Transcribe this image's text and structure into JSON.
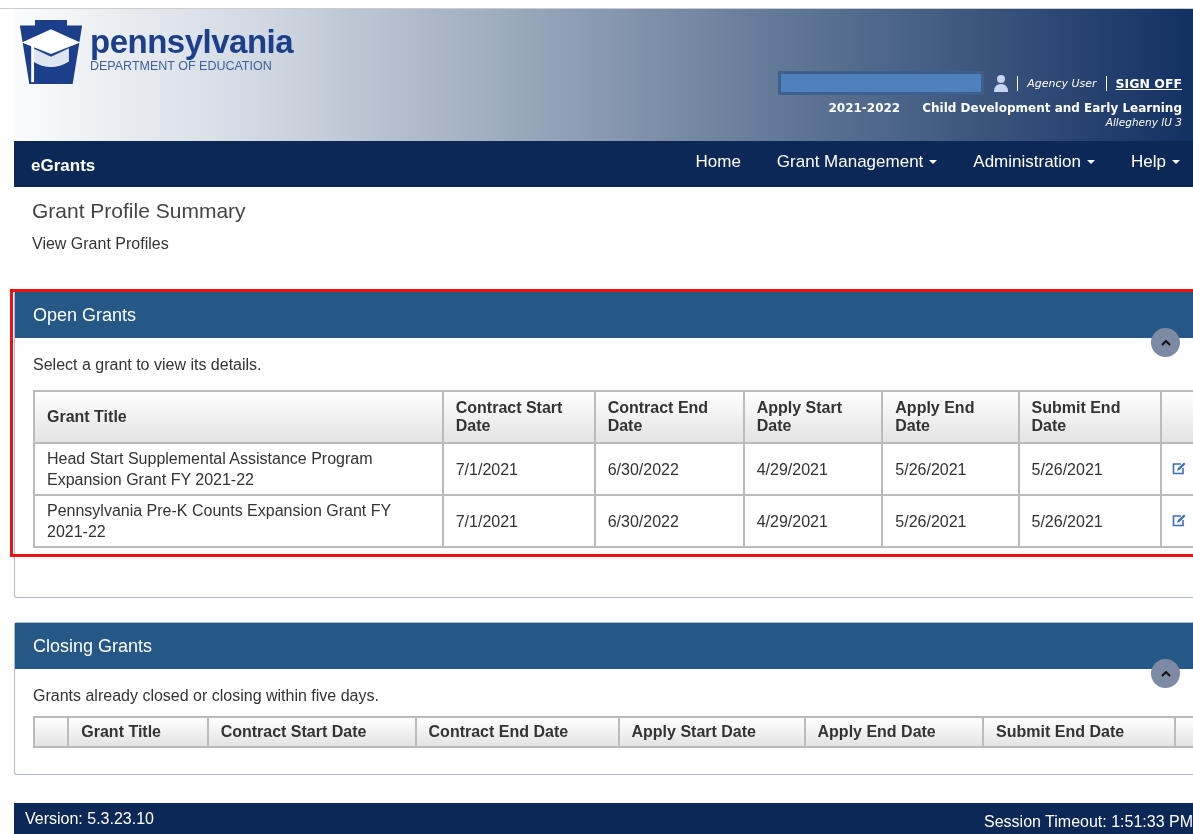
{
  "header": {
    "logo_name": "pennsylvania",
    "logo_subtitle": "DEPARTMENT OF EDUCATION",
    "role": "Agency User",
    "sign_off": "SIGN OFF",
    "year": "2021-2022",
    "office": "Child Development and Early Learning",
    "agency": "Allegheny IU 3"
  },
  "navbar": {
    "brand": "eGrants",
    "items": [
      {
        "label": "Home",
        "dropdown": false
      },
      {
        "label": "Grant Management",
        "dropdown": true
      },
      {
        "label": "Administration",
        "dropdown": true
      },
      {
        "label": "Help",
        "dropdown": true
      }
    ]
  },
  "page": {
    "title": "Grant Profile Summary",
    "link": "View Grant Profiles"
  },
  "open_grants": {
    "title": "Open Grants",
    "expanded": true,
    "instructions": "Select a grant to view its details.",
    "columns": [
      "Grant Title",
      "Contract Start Date",
      "Contract End Date",
      "Apply Start Date",
      "Apply End Date",
      "Submit End Date"
    ],
    "rows": [
      {
        "cells": [
          "Head Start Supplemental Assistance Program Expansion Grant FY 2021-22",
          "7/1/2021",
          "6/30/2022",
          "4/29/2021",
          "5/26/2021",
          "5/26/2021"
        ]
      },
      {
        "cells": [
          "Pennsylvania Pre-K Counts Expansion Grant FY 2021-22",
          "7/1/2021",
          "6/30/2022",
          "4/29/2021",
          "5/26/2021",
          "5/26/2021"
        ]
      }
    ]
  },
  "closing_grants": {
    "title": "Closing Grants",
    "expanded": true,
    "instructions": "Grants already closed or closing within five days.",
    "columns": [
      "Grant Title",
      "Contract Start Date",
      "Contract End Date",
      "Apply Start Date",
      "Apply End Date",
      "Submit End Date"
    ]
  },
  "footer": {
    "version": "Version: 5.3.23.10",
    "session": "Session Timeout: 1:51:33 PM"
  }
}
